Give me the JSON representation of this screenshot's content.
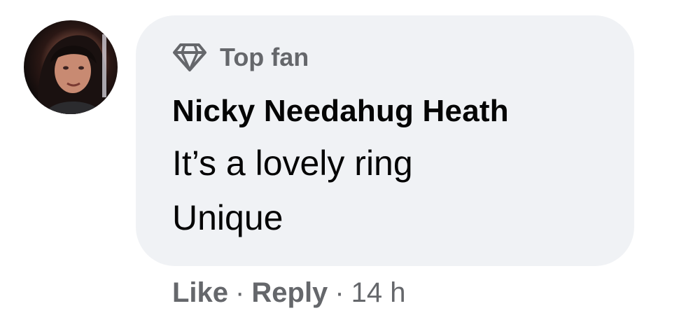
{
  "comment": {
    "badge": {
      "icon": "diamond-icon",
      "label": "Top fan"
    },
    "author": "Nicky Needahug Heath",
    "body_lines": [
      "It’s a lovely ring",
      "Unique"
    ],
    "actions": {
      "like_label": "Like",
      "separator": "·",
      "reply_label": "Reply",
      "timestamp": "14 h"
    }
  },
  "colors": {
    "bubble_background": "#f0f2f5",
    "primary_text": "#050505",
    "secondary_text": "#65676b"
  }
}
